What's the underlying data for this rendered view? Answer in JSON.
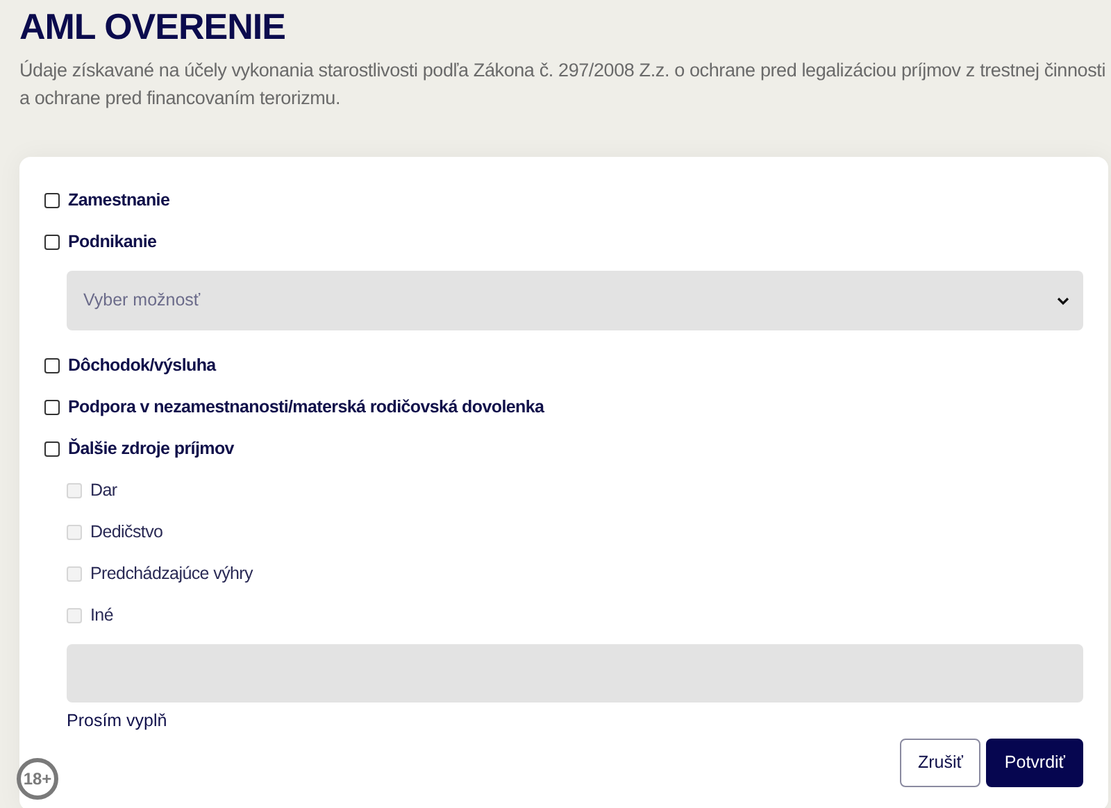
{
  "title": "AML OVERENIE",
  "description": "Údaje získavané na účely vykonania starostlivosti podľa Zákona č. 297/2008 Z.z. o ochrane pred legalizáciou príjmov z trestnej činnosti a ochrane pred financovaním terorizmu.",
  "options": [
    {
      "kind": "checkbox",
      "label": "Zamestnanie",
      "checked": false
    },
    {
      "kind": "checkbox",
      "label": "Podnikanie",
      "checked": false
    },
    {
      "kind": "select",
      "placeholder": "Vyber možnosť"
    },
    {
      "kind": "checkbox",
      "label": "Dôchodok/výsluha",
      "checked": false
    },
    {
      "kind": "checkbox",
      "label": "Podpora v nezamestnanosti/materská rodičovská dovolenka",
      "checked": false
    },
    {
      "kind": "checkbox",
      "label": "Ďalšie zdroje príjmov",
      "checked": false,
      "children": [
        {
          "label": "Dar",
          "checked": false,
          "disabled": true
        },
        {
          "label": "Dedičstvo",
          "checked": false,
          "disabled": true
        },
        {
          "label": "Predchádzajúce výhry",
          "checked": false,
          "disabled": true
        },
        {
          "label": "Iné",
          "checked": false,
          "disabled": true
        }
      ]
    }
  ],
  "note_field": {
    "helper": "Prosím vyplň"
  },
  "buttons": [
    {
      "label": "Zrušiť",
      "kind": "secondary"
    },
    {
      "label": "Potvrdiť",
      "kind": "primary"
    }
  ],
  "age_badge": "18+"
}
